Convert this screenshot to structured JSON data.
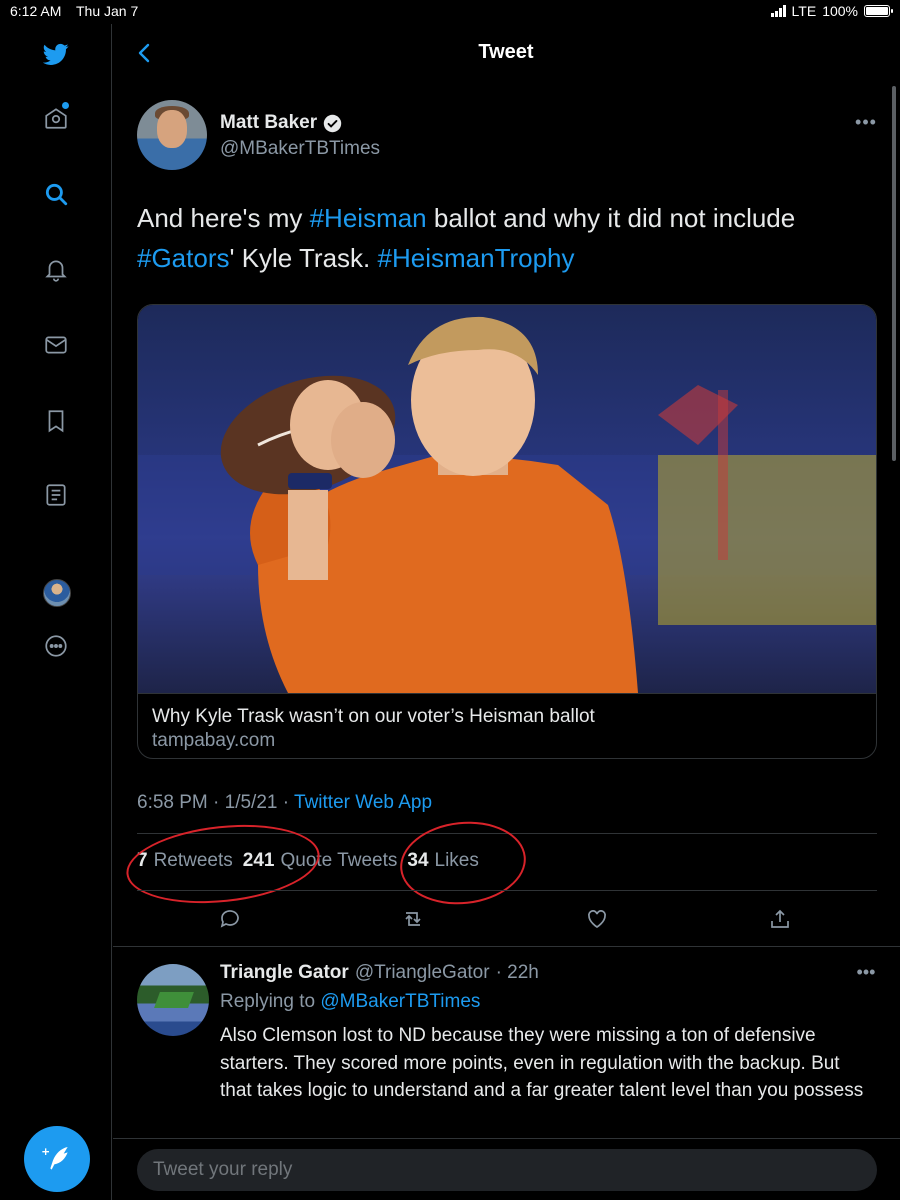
{
  "status_bar": {
    "time": "6:12 AM",
    "date": "Thu Jan 7",
    "network": "LTE",
    "battery": "100%",
    "battery_level": 1.0
  },
  "colors": {
    "accent": "#1d9bf0",
    "background": "#000000",
    "annotation": "#d8232a"
  },
  "nav": {
    "items": [
      {
        "icon": "twitter-logo-icon"
      },
      {
        "icon": "home-icon"
      },
      {
        "icon": "search-icon"
      },
      {
        "icon": "notifications-icon"
      },
      {
        "icon": "messages-icon"
      },
      {
        "icon": "bookmarks-icon"
      },
      {
        "icon": "lists-icon"
      },
      {
        "icon": "profile-avatar"
      },
      {
        "icon": "more-icon"
      }
    ],
    "compose_icon": "compose-tweet-icon"
  },
  "header": {
    "title": "Tweet",
    "back_icon": "back-arrow-icon"
  },
  "tweet": {
    "author_name": "Matt Baker",
    "author_handle": "@MBakerTBTimes",
    "text_parts": {
      "p1": "And here's my ",
      "tag1": "#Heisman",
      "p2": " ballot and why it did not include ",
      "tag2": "#Gators",
      "p3": "' Kyle Trask. ",
      "tag3": "#HeismanTrophy"
    },
    "card": {
      "title": "Why Kyle Trask wasn’t on our voter’s Heisman ballot",
      "domain": "tampabay.com"
    },
    "timestamp": "6:58 PM · 1/5/21 · ",
    "source": "Twitter Web App",
    "stats": {
      "retweets_count": "7",
      "retweets_label": "Retweets",
      "quotes_count": "241",
      "quotes_label": "Quote Tweets",
      "likes_count": "34",
      "likes_label": "Likes"
    },
    "actions": [
      "reply-icon",
      "retweet-icon",
      "like-icon",
      "share-icon"
    ]
  },
  "reply": {
    "author_name": "Triangle Gator",
    "author_handle": "@TriangleGator",
    "time": "· 22h",
    "replying_prefix": "Replying to ",
    "replying_to": "@MBakerTBTimes",
    "text": "Also Clemson lost to ND because they were missing a ton of defensive starters. They scored more points, even in regulation with the backup. But that takes logic to understand and a far greater talent level than you possess"
  },
  "reply_bar": {
    "placeholder": "Tweet your reply"
  }
}
